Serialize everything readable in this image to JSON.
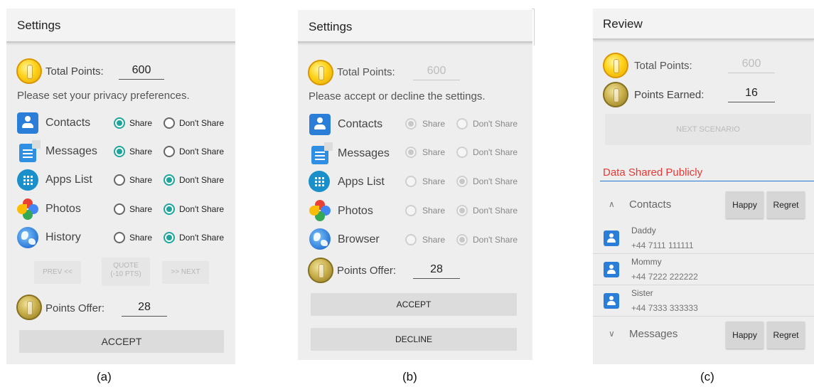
{
  "panel_a": {
    "title": "Settings",
    "total_points_label": "Total Points:",
    "total_points_value": "600",
    "prompt": "Please set your privacy preferences.",
    "permissions": [
      {
        "name": "Contacts",
        "icon": "contacts-icon",
        "share_label": "Share",
        "dont_label": "Don't Share",
        "selected": "share"
      },
      {
        "name": "Messages",
        "icon": "messages-icon",
        "share_label": "Share",
        "dont_label": "Don't Share",
        "selected": "share"
      },
      {
        "name": "Apps List",
        "icon": "apps-icon",
        "share_label": "Share",
        "dont_label": "Don't Share",
        "selected": "dont"
      },
      {
        "name": "Photos",
        "icon": "photos-icon",
        "share_label": "Share",
        "dont_label": "Don't Share",
        "selected": "dont"
      },
      {
        "name": "History",
        "icon": "history-icon",
        "share_label": "Share",
        "dont_label": "Don't Share",
        "selected": "dont"
      }
    ],
    "prev_label": "PREV <<",
    "quote_label_1": "QUOTE",
    "quote_label_2": "(-10 PTS)",
    "next_label": ">> NEXT",
    "points_offer_label": "Points Offer:",
    "points_offer_value": "28",
    "accept_label": "ACCEPT"
  },
  "panel_b": {
    "title": "Settings",
    "total_points_label": "Total Points:",
    "total_points_value": "600",
    "prompt": "Please accept or decline the settings.",
    "permissions": [
      {
        "name": "Contacts",
        "icon": "contacts-icon",
        "share_label": "Share",
        "dont_label": "Don't Share",
        "selected": "share"
      },
      {
        "name": "Messages",
        "icon": "messages-icon",
        "share_label": "Share",
        "dont_label": "Don't Share",
        "selected": "share"
      },
      {
        "name": "Apps List",
        "icon": "apps-icon",
        "share_label": "Share",
        "dont_label": "Don't Share",
        "selected": "dont"
      },
      {
        "name": "Photos",
        "icon": "photos-icon",
        "share_label": "Share",
        "dont_label": "Don't Share",
        "selected": "dont"
      },
      {
        "name": "Browser",
        "icon": "browser-icon",
        "share_label": "Share",
        "dont_label": "Don't Share",
        "selected": "dont"
      }
    ],
    "points_offer_label": "Points Offer:",
    "points_offer_value": "28",
    "accept_label": "ACCEPT",
    "decline_label": "DECLINE"
  },
  "panel_c": {
    "title": "Review",
    "total_points_label": "Total Points:",
    "total_points_value": "600",
    "points_earned_label": "Points Earned:",
    "points_earned_value": "16",
    "next_scenario_label": "NEXT SCENARIO",
    "section_title": "Data Shared Publicly",
    "happy_label": "Happy",
    "regret_label": "Regret",
    "groups": [
      {
        "name": "Contacts",
        "chevron": "^"
      },
      {
        "name": "Messages",
        "chevron": "v"
      }
    ],
    "contacts": [
      {
        "name": "Daddy",
        "number": "+44 7111 111111"
      },
      {
        "name": "Mommy",
        "number": "+44 7222 222222"
      },
      {
        "name": "Sister",
        "number": "+44 7333 333333"
      }
    ]
  },
  "captions": [
    "(a)",
    "(b)",
    "(c)"
  ],
  "colors": {
    "accent_teal": "#1fa59d",
    "section_red": "#e53935",
    "divider_blue": "#1f77d0",
    "coin_gold": "#ffd21a"
  }
}
